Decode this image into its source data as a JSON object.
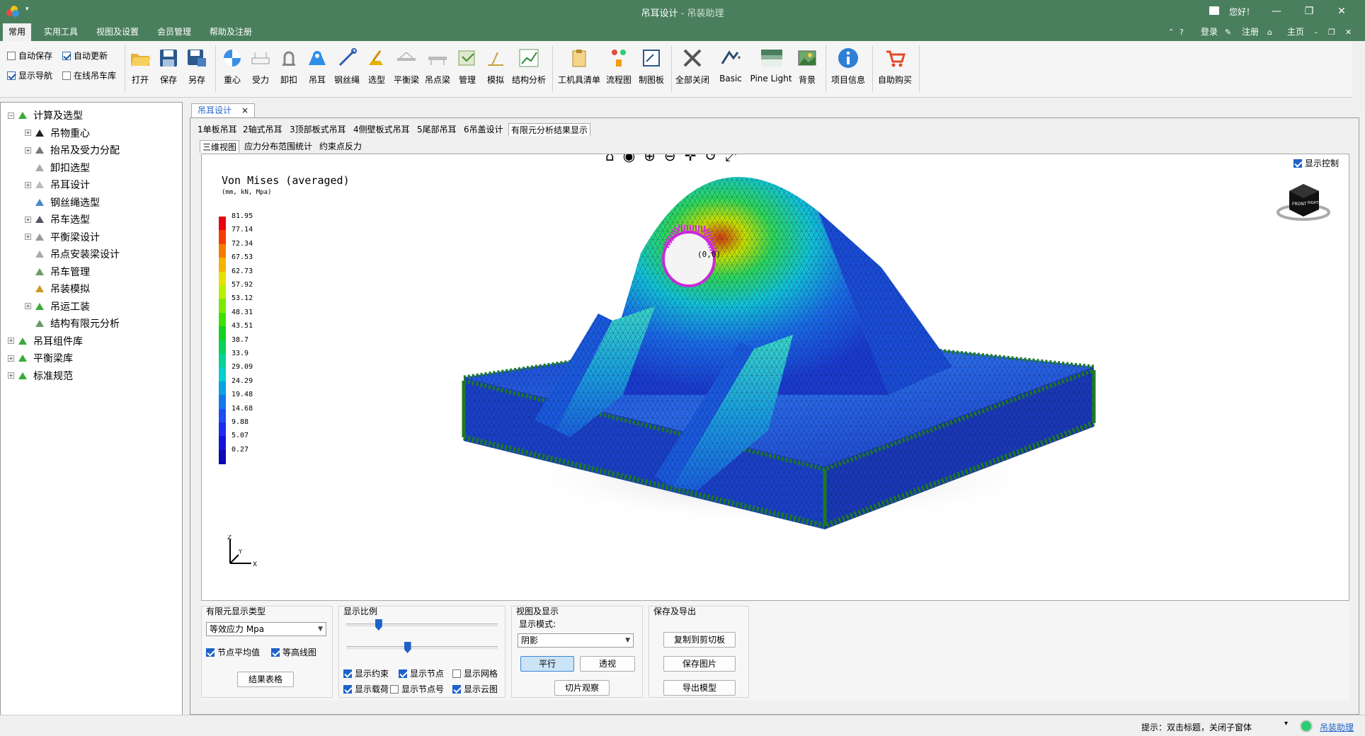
{
  "window": {
    "title": "吊耳设计",
    "subtitle": " - 吊装助理",
    "greeting": "您好！"
  },
  "menu": {
    "items": [
      "常用",
      "实用工具",
      "视图及设置",
      "会员管理",
      "帮助及注册"
    ],
    "active": "常用",
    "right": {
      "login": "登录",
      "register": "注册",
      "home": "主页"
    }
  },
  "ribbon": {
    "options": [
      {
        "label": "自动保存",
        "checked": false
      },
      {
        "label": "自动更新",
        "checked": true
      },
      {
        "label": "显示导航",
        "checked": true
      },
      {
        "label": "在线吊车库",
        "checked": false
      }
    ],
    "buttons": [
      {
        "label": "打开",
        "icon": "folder-open-icon"
      },
      {
        "label": "保存",
        "icon": "save-icon"
      },
      {
        "label": "另存",
        "icon": "save-as-icon"
      },
      {
        "label": "重心",
        "icon": "center-gravity-icon"
      },
      {
        "label": "受力",
        "icon": "force-icon"
      },
      {
        "label": "卸扣",
        "icon": "shackle-icon"
      },
      {
        "label": "吊耳",
        "icon": "lug-icon"
      },
      {
        "label": "钢丝绳",
        "icon": "wire-rope-icon"
      },
      {
        "label": "选型",
        "icon": "crane-select-icon"
      },
      {
        "label": "平衡梁",
        "icon": "balance-beam-icon"
      },
      {
        "label": "吊点梁",
        "icon": "lift-beam-icon"
      },
      {
        "label": "管理",
        "icon": "manage-icon"
      },
      {
        "label": "模拟",
        "icon": "simulate-icon"
      },
      {
        "label": "结构分析",
        "icon": "structure-analysis-icon"
      },
      {
        "label": "工机具清单",
        "icon": "clipboard-icon"
      },
      {
        "label": "流程图",
        "icon": "flowchart-icon"
      },
      {
        "label": "制图板",
        "icon": "drawing-board-icon"
      },
      {
        "label": "全部关闭",
        "icon": "close-all-icon"
      },
      {
        "label": "Basic",
        "icon": "theme-basic-icon"
      },
      {
        "label": "Pine Light",
        "icon": "theme-pine-icon"
      },
      {
        "label": "背景",
        "icon": "background-icon"
      },
      {
        "label": "项目信息",
        "icon": "info-icon"
      },
      {
        "label": "自助购买",
        "icon": "cart-icon"
      }
    ]
  },
  "sidebar": {
    "items": [
      {
        "label": "计算及选型",
        "level": 0
      },
      {
        "label": "吊物重心",
        "level": 1
      },
      {
        "label": "抬吊及受力分配",
        "level": 1
      },
      {
        "label": "卸扣选型",
        "level": 1
      },
      {
        "label": "吊耳设计",
        "level": 1
      },
      {
        "label": "钢丝绳选型",
        "level": 1
      },
      {
        "label": "吊车选型",
        "level": 1
      },
      {
        "label": "平衡梁设计",
        "level": 1
      },
      {
        "label": "吊点安装梁设计",
        "level": 1
      },
      {
        "label": "吊车管理",
        "level": 1
      },
      {
        "label": "吊装模拟",
        "level": 1
      },
      {
        "label": "吊运工装",
        "level": 1
      },
      {
        "label": "结构有限元分析",
        "level": 1
      },
      {
        "label": "吊耳组件库",
        "level": 0
      },
      {
        "label": "平衡梁库",
        "level": 0
      },
      {
        "label": "标准规范",
        "level": 0
      }
    ]
  },
  "doc_tab": {
    "label": "吊耳设计",
    "close": "×"
  },
  "tabs": [
    "1单板吊耳",
    "2轴式吊耳",
    "3顶部板式吊耳",
    "4侧壁板式吊耳",
    "5尾部吊耳",
    "6吊盖设计",
    "有限元分析结果显示"
  ],
  "active_tab": "有限元分析结果显示",
  "subtabs": [
    "三维视图",
    "应力分布范围统计",
    "约束点反力"
  ],
  "active_subtab": "三维视图",
  "viewport": {
    "title": "Von Mises (averaged)",
    "units": "(mm, kN, Mpa)",
    "legend_values": [
      "81.95",
      "77.14",
      "72.34",
      "67.53",
      "62.73",
      "57.92",
      "53.12",
      "48.31",
      "43.51",
      "38.7",
      "33.9",
      "29.09",
      "24.29",
      "19.48",
      "14.68",
      "9.88",
      "5.07",
      "0.27"
    ],
    "legend_colors": [
      "#e8000b",
      "#f23d00",
      "#f77a00",
      "#f5b300",
      "#e8e000",
      "#b8f000",
      "#7aeb00",
      "#3fe000",
      "#14d21e",
      "#0ad25a",
      "#08d296",
      "#06cfcf",
      "#0aa3e0",
      "#1478eb",
      "#1e4ef0",
      "#1e2bf0",
      "#1414d8",
      "#0a0ab4"
    ],
    "show_control_label": "显示控制",
    "show_control": true,
    "node_label": "(0,0)",
    "cube_labels": {
      "front": "FRONT",
      "right": "RIGHT"
    },
    "axes": {
      "z": "Z",
      "y": "Y",
      "x": "X"
    }
  },
  "panel": {
    "fe_type": {
      "title": "有限元显示类型",
      "select": "等效应力 Mpa",
      "node_avg": {
        "label": "节点平均值",
        "checked": true
      },
      "contour": {
        "label": "等高线图",
        "checked": true
      },
      "result_table": "结果表格"
    },
    "scale": {
      "title": "显示比例",
      "slider1": 0.2,
      "slider2": 0.4,
      "checks": [
        {
          "label": "显示约束",
          "checked": true
        },
        {
          "label": "显示节点",
          "checked": true
        },
        {
          "label": "显示网格",
          "checked": false
        },
        {
          "label": "显示载荷",
          "checked": true
        },
        {
          "label": "显示节点号",
          "checked": false
        },
        {
          "label": "显示云图",
          "checked": true
        }
      ]
    },
    "view": {
      "title": "视图及显示",
      "mode_label": "显示模式:",
      "mode": "阴影",
      "parallel": "平行",
      "perspective": "透视",
      "slice": "切片观察"
    },
    "export": {
      "title": "保存及导出",
      "copy": "复制到剪切板",
      "save_img": "保存图片",
      "export_model": "导出模型"
    }
  },
  "status": {
    "hint": "提示：双击标题，关闭子窗体",
    "app": "吊装助理"
  }
}
